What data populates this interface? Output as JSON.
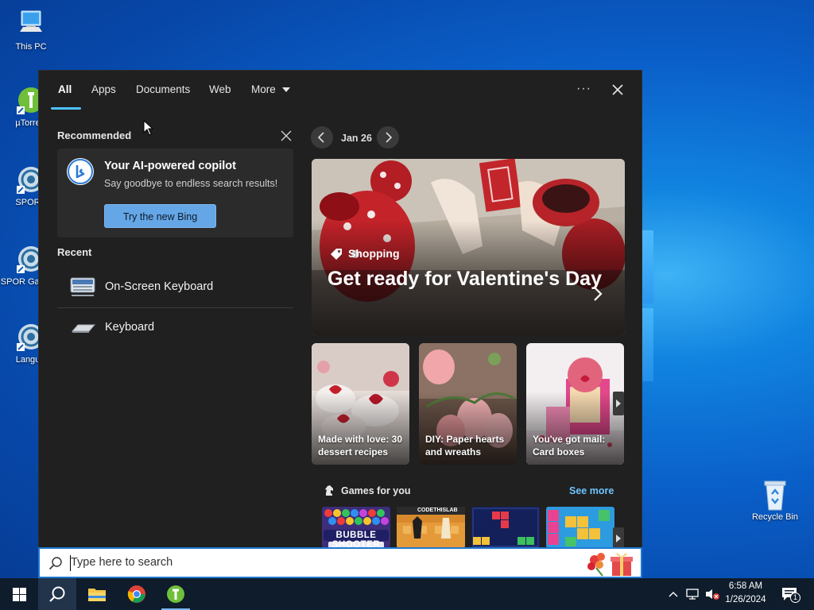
{
  "desktop": {
    "icons": [
      {
        "label": "This PC"
      },
      {
        "label": "µTorre"
      },
      {
        "label": "SPOR"
      },
      {
        "label": "SPOR Galacti"
      },
      {
        "label": "Langu"
      },
      {
        "label": "Recycle Bin"
      }
    ]
  },
  "search_panel": {
    "tabs": [
      {
        "label": "All",
        "active": true
      },
      {
        "label": "Apps"
      },
      {
        "label": "Documents"
      },
      {
        "label": "Web"
      },
      {
        "label": "More"
      }
    ],
    "more_icon": "caret-down-icon",
    "options_icon": "ellipsis-icon",
    "close_icon": "close-icon",
    "recommended": {
      "title": "Recommended",
      "card_title": "Your AI-powered copilot",
      "card_subtitle": "Say goodbye to endless search results!",
      "button_label": "Try the new Bing"
    },
    "recent": {
      "title": "Recent",
      "items": [
        {
          "label": "On-Screen Keyboard",
          "icon": "on-screen-keyboard-icon"
        },
        {
          "label": "Keyboard",
          "icon": "keyboard-icon"
        }
      ]
    },
    "highlights": {
      "date": "Jan 26",
      "hero": {
        "category": "Shopping",
        "title": "Get ready for Valentine's Day"
      },
      "tiles": [
        {
          "caption": "Made with love: 30 dessert recipes"
        },
        {
          "caption": "DIY: Paper hearts and wreaths"
        },
        {
          "caption": "You've got mail: Card boxes"
        }
      ],
      "games": {
        "title": "Games for you",
        "see_more": "See more",
        "items": [
          {
            "name": "BUBBLE SHOOTER"
          },
          {
            "name": "CODETHISLAB"
          },
          {
            "name": "block-puzzle-1"
          },
          {
            "name": "block-puzzle-2"
          }
        ]
      }
    }
  },
  "search_bar": {
    "placeholder": "Type here to search"
  },
  "taskbar": {
    "time": "6:58 AM",
    "date": "1/26/2024",
    "notification_count": "1",
    "accent": "#4cc2ff"
  }
}
